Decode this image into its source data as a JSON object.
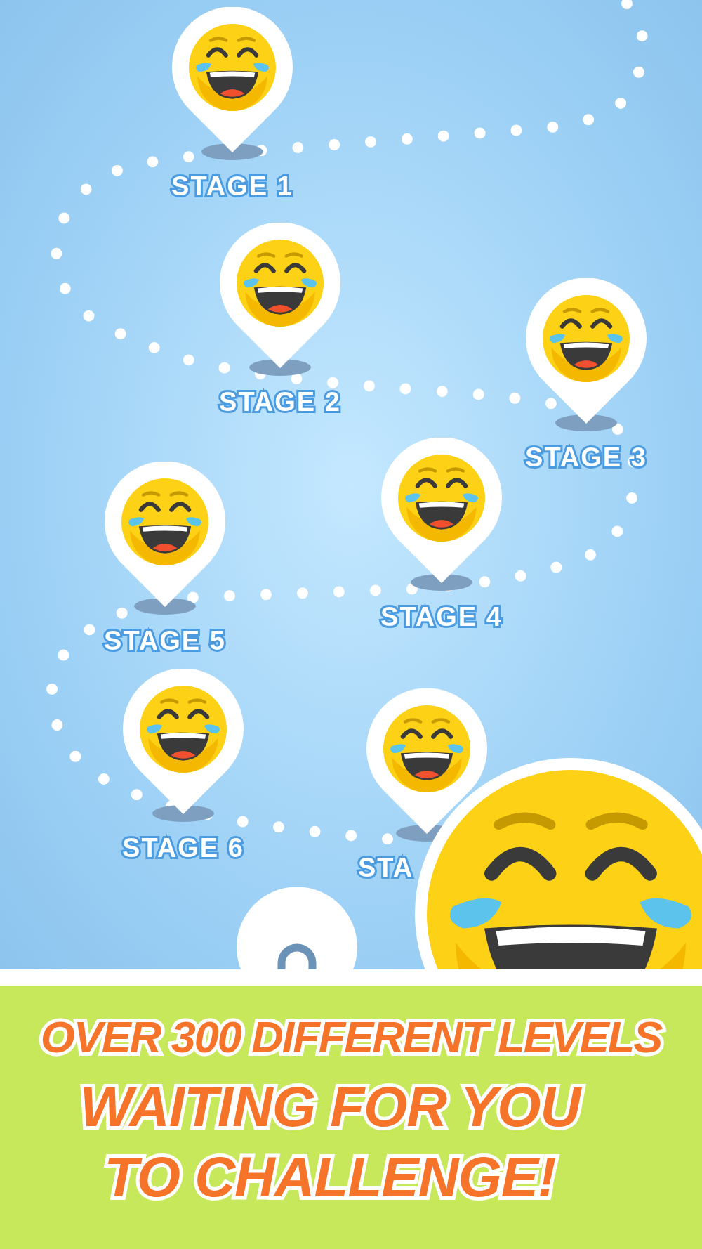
{
  "stages": [
    {
      "kind": "open",
      "label": "STAGE 1"
    },
    {
      "kind": "open",
      "label": "STAGE 2"
    },
    {
      "kind": "open",
      "label": "STAGE 3"
    },
    {
      "kind": "open",
      "label": "STAGE 4"
    },
    {
      "kind": "open",
      "label": "STAGE 5"
    },
    {
      "kind": "open",
      "label": "STAGE 6"
    },
    {
      "kind": "open",
      "label": "STA"
    },
    {
      "kind": "locked"
    }
  ],
  "headline": [
    "OVER 300 DIFFERENT LEVELS",
    "WAITING FOR YOU",
    "TO CHALLENGE!"
  ]
}
